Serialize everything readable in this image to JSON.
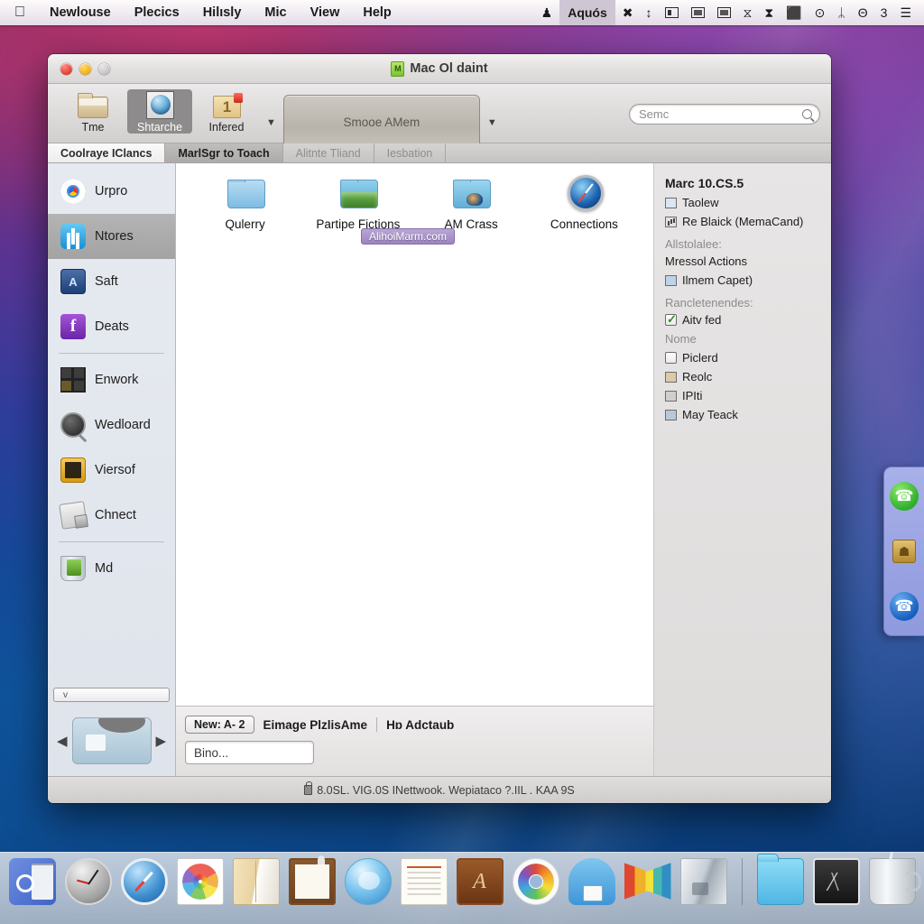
{
  "menubar": {
    "apple_icon": "apple-logo",
    "items": [
      "Newlouse",
      "Plecics",
      "Hilısly",
      "Mic",
      "View",
      "Help"
    ],
    "right_items": [
      {
        "name": "status-icon-bird",
        "glyph": "♟"
      },
      {
        "name": "menu-extra-aquos",
        "label": "Aquós",
        "selected": true
      },
      {
        "name": "close-x-icon",
        "glyph": "✖"
      },
      {
        "name": "vol-icon",
        "glyph": "↕"
      },
      {
        "name": "battery-icon",
        "glyph": "▤"
      },
      {
        "name": "display-icon",
        "glyph": "▣"
      },
      {
        "name": "chart-icon",
        "glyph": "▨"
      },
      {
        "name": "hourglass-icon",
        "glyph": "⧖"
      },
      {
        "name": "hourglass2-icon",
        "glyph": "⧗"
      },
      {
        "name": "clipboard-icon",
        "glyph": "⬛"
      },
      {
        "name": "timemachine-icon",
        "glyph": "⊙"
      },
      {
        "name": "bluetooth-icon",
        "glyph": "ᛦ"
      },
      {
        "name": "clock-label",
        "label": "Θ"
      },
      {
        "name": "count-label",
        "label": "3"
      },
      {
        "name": "spotlight-icon",
        "glyph": "☰"
      }
    ]
  },
  "window": {
    "title": "Mac Ol daint",
    "title_icon": "document-icon",
    "traffic": {
      "close": "close-button",
      "minimize": "minimize-button",
      "zoom": "zoom-button"
    },
    "toolbar": {
      "items": [
        {
          "label": "Tme",
          "icon": "folder-icon",
          "active": false
        },
        {
          "label": "Shtarche",
          "icon": "globe-in-box-icon",
          "active": true
        },
        {
          "label": "Infered",
          "icon": "numbered-folder-icon",
          "active": false
        }
      ],
      "caret_left": "chevron-down-icon",
      "path_button": "Smooe AMem",
      "caret_right": "chevron-down-icon",
      "search_placeholder": "Semc",
      "search_value": ""
    },
    "tabs": [
      {
        "label": "Coolraye IClancs",
        "state": "active"
      },
      {
        "label": "MarlSgr to Toach",
        "state": "current"
      },
      {
        "label": "Alitnte Tliand",
        "state": "dim"
      },
      {
        "label": "Iesbation",
        "state": "dim"
      }
    ],
    "sidebar": {
      "groups": [
        {
          "items": [
            {
              "label": "Urpro",
              "icon": "chrome-icon",
              "selected": false
            },
            {
              "label": "Ntores",
              "icon": "app-store-icon",
              "selected": true
            },
            {
              "label": "Saft",
              "icon": "blue-app-icon",
              "selected": false
            },
            {
              "label": "Deats",
              "icon": "facebook-icon",
              "selected": false
            }
          ]
        },
        {
          "items": [
            {
              "label": "Enwork",
              "icon": "grid-icon",
              "selected": false
            },
            {
              "label": "Wedloard",
              "icon": "magnifier-icon",
              "selected": false
            },
            {
              "label": "Viersof",
              "icon": "amber-app-icon",
              "selected": false
            },
            {
              "label": "Chnect",
              "icon": "card-stack-icon",
              "selected": false
            }
          ]
        },
        {
          "items": [
            {
              "label": "Md",
              "icon": "trash-icon",
              "selected": false
            }
          ]
        }
      ],
      "scroll_hint": "v",
      "nav_prev": "prev-arrow",
      "nav_next": "next-arrow",
      "thumbnail": "preview-thumbnail"
    },
    "content": {
      "icons": [
        {
          "label": "Qulerry",
          "icon": "plain-folder-icon"
        },
        {
          "label": "Partipe Fictions",
          "icon": "photo-folder-icon"
        },
        {
          "label": "AM Crass",
          "icon": "image-folder-icon"
        },
        {
          "label": "Connections",
          "icon": "compass-icon"
        }
      ],
      "tag_pill": "AlihoiMarm.com"
    },
    "bottom": {
      "new_button": "New: A-  2",
      "label_1": "Eimage PlzlisAme",
      "label_2": "Hɒ Adctaub",
      "input_value": "Bino..."
    },
    "info_panel": {
      "title": "Marc 10.CS.5",
      "rows_top": [
        {
          "label": "Taolew",
          "icon": "window-icon"
        },
        {
          "label": "Re Blaick (MemaCand)",
          "icon": "chart-icon"
        }
      ],
      "section_1_label": "Allstolalee:",
      "rows_mid": [
        {
          "label": "Mressol Actions",
          "icon": "none"
        },
        {
          "label": "Ilmem Capet)",
          "icon": "image-icon"
        }
      ],
      "section_2_label": "Rancletenendes:",
      "rows_bottom": [
        {
          "label": "Aitv fed",
          "icon": "checkbox",
          "checked": true
        },
        {
          "label": "Nome",
          "icon": "none",
          "dim": true
        },
        {
          "label": "Piclerd",
          "icon": "checkbox",
          "checked": false
        },
        {
          "label": "Reolc",
          "icon": "picture-icon"
        },
        {
          "label": "IPIti",
          "icon": "network-icon"
        },
        {
          "label": "May Teack",
          "icon": "tv-icon"
        }
      ]
    },
    "statusbar": {
      "lock_icon": "lock-icon",
      "text": "8.0SL. VIG.0S INettwook.  Wepiataco ?.IIL . KAA 9S"
    }
  },
  "widget": {
    "items": [
      {
        "name": "phone-green-icon",
        "glyph": "☎"
      },
      {
        "name": "gold-badge-icon",
        "glyph": "☗"
      },
      {
        "name": "phone-blue-icon",
        "glyph": "☎"
      }
    ]
  },
  "dock": {
    "left_items": [
      {
        "name": "system-preferences-icon",
        "class": "d-sysprefs"
      },
      {
        "name": "clock-icon",
        "class": "d-clock"
      },
      {
        "name": "safari-icon",
        "class": "d-safari"
      },
      {
        "name": "photos-icon",
        "class": "d-photos"
      },
      {
        "name": "documents-icon",
        "class": "d-docs"
      },
      {
        "name": "notes-icon",
        "class": "d-note"
      },
      {
        "name": "ichat-icon",
        "class": "d-ichat"
      },
      {
        "name": "pages-icon",
        "class": "d-pages"
      },
      {
        "name": "app-icon",
        "class": "d-app"
      },
      {
        "name": "color-wheel-icon",
        "class": "d-color"
      },
      {
        "name": "printer-icon",
        "class": "d-printer"
      },
      {
        "name": "prism-icon",
        "class": "d-prism"
      },
      {
        "name": "glass-icon",
        "class": "d-glass"
      }
    ],
    "right_items": [
      {
        "name": "folder-icon",
        "class": "d-folder"
      },
      {
        "name": "downloads-icon",
        "class": "d-dl"
      },
      {
        "name": "trash-cup-icon",
        "class": "d-trashcup"
      }
    ]
  },
  "colors": {
    "accent_purple": "#9c85c2",
    "desktop_top": "#8e2a60",
    "desktop_bottom": "#0a3168",
    "selection_gray": "#a3a3a3"
  }
}
